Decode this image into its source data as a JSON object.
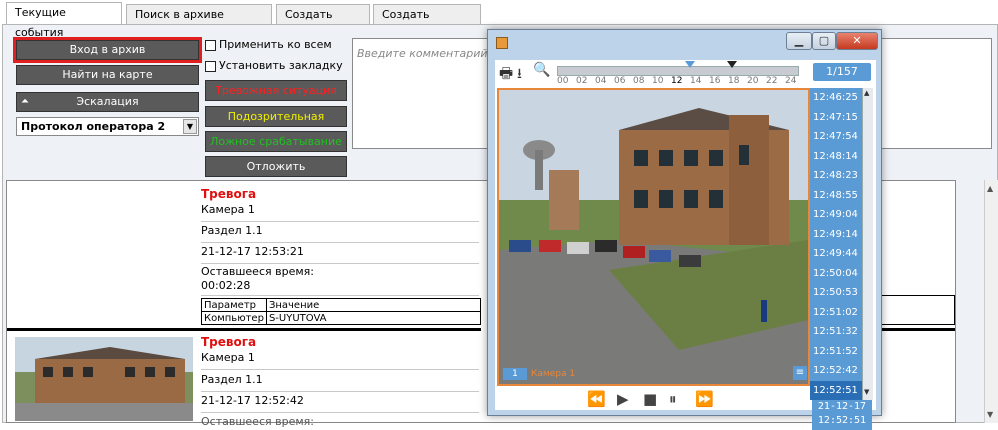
{
  "tabs": [
    "Текущие события",
    "Поиск в архиве событий",
    "Создать отчет",
    "Создать событие"
  ],
  "left_buttons": {
    "archive": "Вход в архив",
    "map": "Найти на карте",
    "escalation": "Эскалация",
    "protocol_select": "Протокол оператора 2"
  },
  "checkboxes": {
    "apply_all": "Применить ко всем",
    "bookmark": "Установить закладку"
  },
  "situations": {
    "alarm": "Тревожная ситуация",
    "suspicious": "Подозрительная ситуация",
    "false": "Ложное срабатывание",
    "defer": "Отложить"
  },
  "colors": {
    "alarm": "#ff2020",
    "suspicious": "#f0f000",
    "false": "#20c020",
    "highlight": "#e02020",
    "accent": "#5b9bd5"
  },
  "comment": {
    "placeholder": "Введите комментарий"
  },
  "events": [
    {
      "title": "Тревога",
      "camera": "Камера 1",
      "section": "Раздел 1.1",
      "datetime": "21-12-17 12:53:21",
      "remaining_label": "Оставшееся время:",
      "remaining_value": "00:02:28",
      "param_headers": [
        "Параметр",
        "Значение"
      ],
      "params": [
        [
          "Компьютер",
          "S-UYUTOVA"
        ]
      ]
    },
    {
      "title": "Тревога",
      "camera": "Камера 1",
      "section": "Раздел 1.1",
      "datetime": "21-12-17 12:52:42",
      "remaining_label": "Оставшееся время:"
    }
  ],
  "video": {
    "counter": "1/157",
    "scale_labels": [
      "00",
      "02",
      "04",
      "06",
      "08",
      "10",
      "12",
      "14",
      "16",
      "18",
      "20",
      "22",
      "24"
    ],
    "times": [
      "12:46:25",
      "12:47:15",
      "12:47:54",
      "12:48:14",
      "12:48:23",
      "12:48:55",
      "12:49:04",
      "12:49:14",
      "12:49:44",
      "12:50:04",
      "12:50:53",
      "12:51:02",
      "12:51:32",
      "12:51:52",
      "12:52:42",
      "12:52:51"
    ],
    "camera_id": "1",
    "camera_name": "Камера 1",
    "date": "21-12-17",
    "time": "12:52:51",
    "icons": [
      "print-icon",
      "download-icon",
      "zoom-icon",
      "rewind-icon",
      "play-icon",
      "stop-icon",
      "pause-icon",
      "fast-forward-icon"
    ]
  }
}
